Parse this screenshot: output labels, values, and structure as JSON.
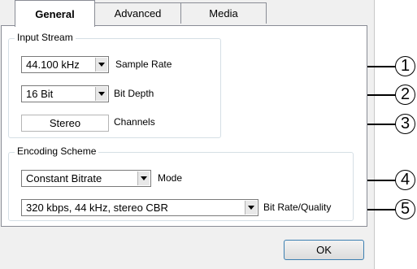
{
  "tabs": [
    {
      "label": "General"
    },
    {
      "label": "Advanced"
    },
    {
      "label": "Media"
    }
  ],
  "input_stream": {
    "legend": "Input Stream",
    "sample_rate": {
      "value": "44.100 kHz",
      "label": "Sample Rate"
    },
    "bit_depth": {
      "value": "16 Bit",
      "label": "Bit Depth"
    },
    "channels": {
      "value": "Stereo",
      "label": "Channels"
    }
  },
  "encoding_scheme": {
    "legend": "Encoding Scheme",
    "mode": {
      "value": "Constant Bitrate",
      "label": "Mode"
    },
    "bit_rate": {
      "value": "320 kbps, 44 kHz, stereo CBR",
      "label": "Bit Rate/Quality"
    }
  },
  "callouts": [
    "1",
    "2",
    "3",
    "4",
    "5"
  ],
  "footer": {
    "ok_label": "OK"
  }
}
